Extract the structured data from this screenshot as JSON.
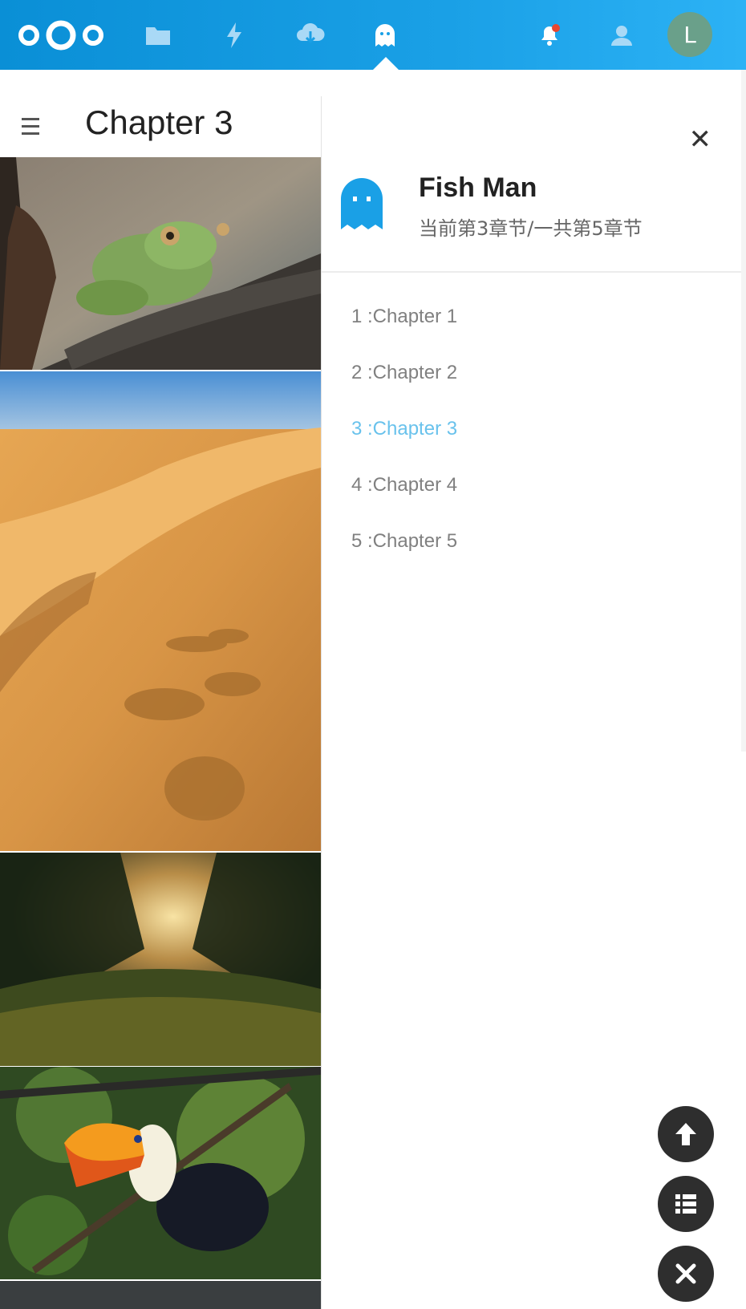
{
  "header": {
    "apps": [
      {
        "name": "files-icon"
      },
      {
        "name": "activity-icon"
      },
      {
        "name": "cloud-download-icon"
      },
      {
        "name": "ghost-icon",
        "active": true
      }
    ],
    "avatar_initial": "L",
    "accent": "#1aa0e6"
  },
  "page": {
    "chapter_title": "Chapter 3"
  },
  "sidebar": {
    "book_title": "Fish Man",
    "book_subtitle": "当前第3章节/一共第5章节",
    "chapters": [
      {
        "label": "1 :Chapter 1"
      },
      {
        "label": "2 :Chapter 2"
      },
      {
        "label": "3 :Chapter 3",
        "active": true
      },
      {
        "label": "4 :Chapter 4"
      },
      {
        "label": "5 :Chapter 5"
      }
    ]
  },
  "images": [
    {
      "name": "frog-image"
    },
    {
      "name": "desert-image"
    },
    {
      "name": "sunset-field-image"
    },
    {
      "name": "toucan-image"
    }
  ]
}
